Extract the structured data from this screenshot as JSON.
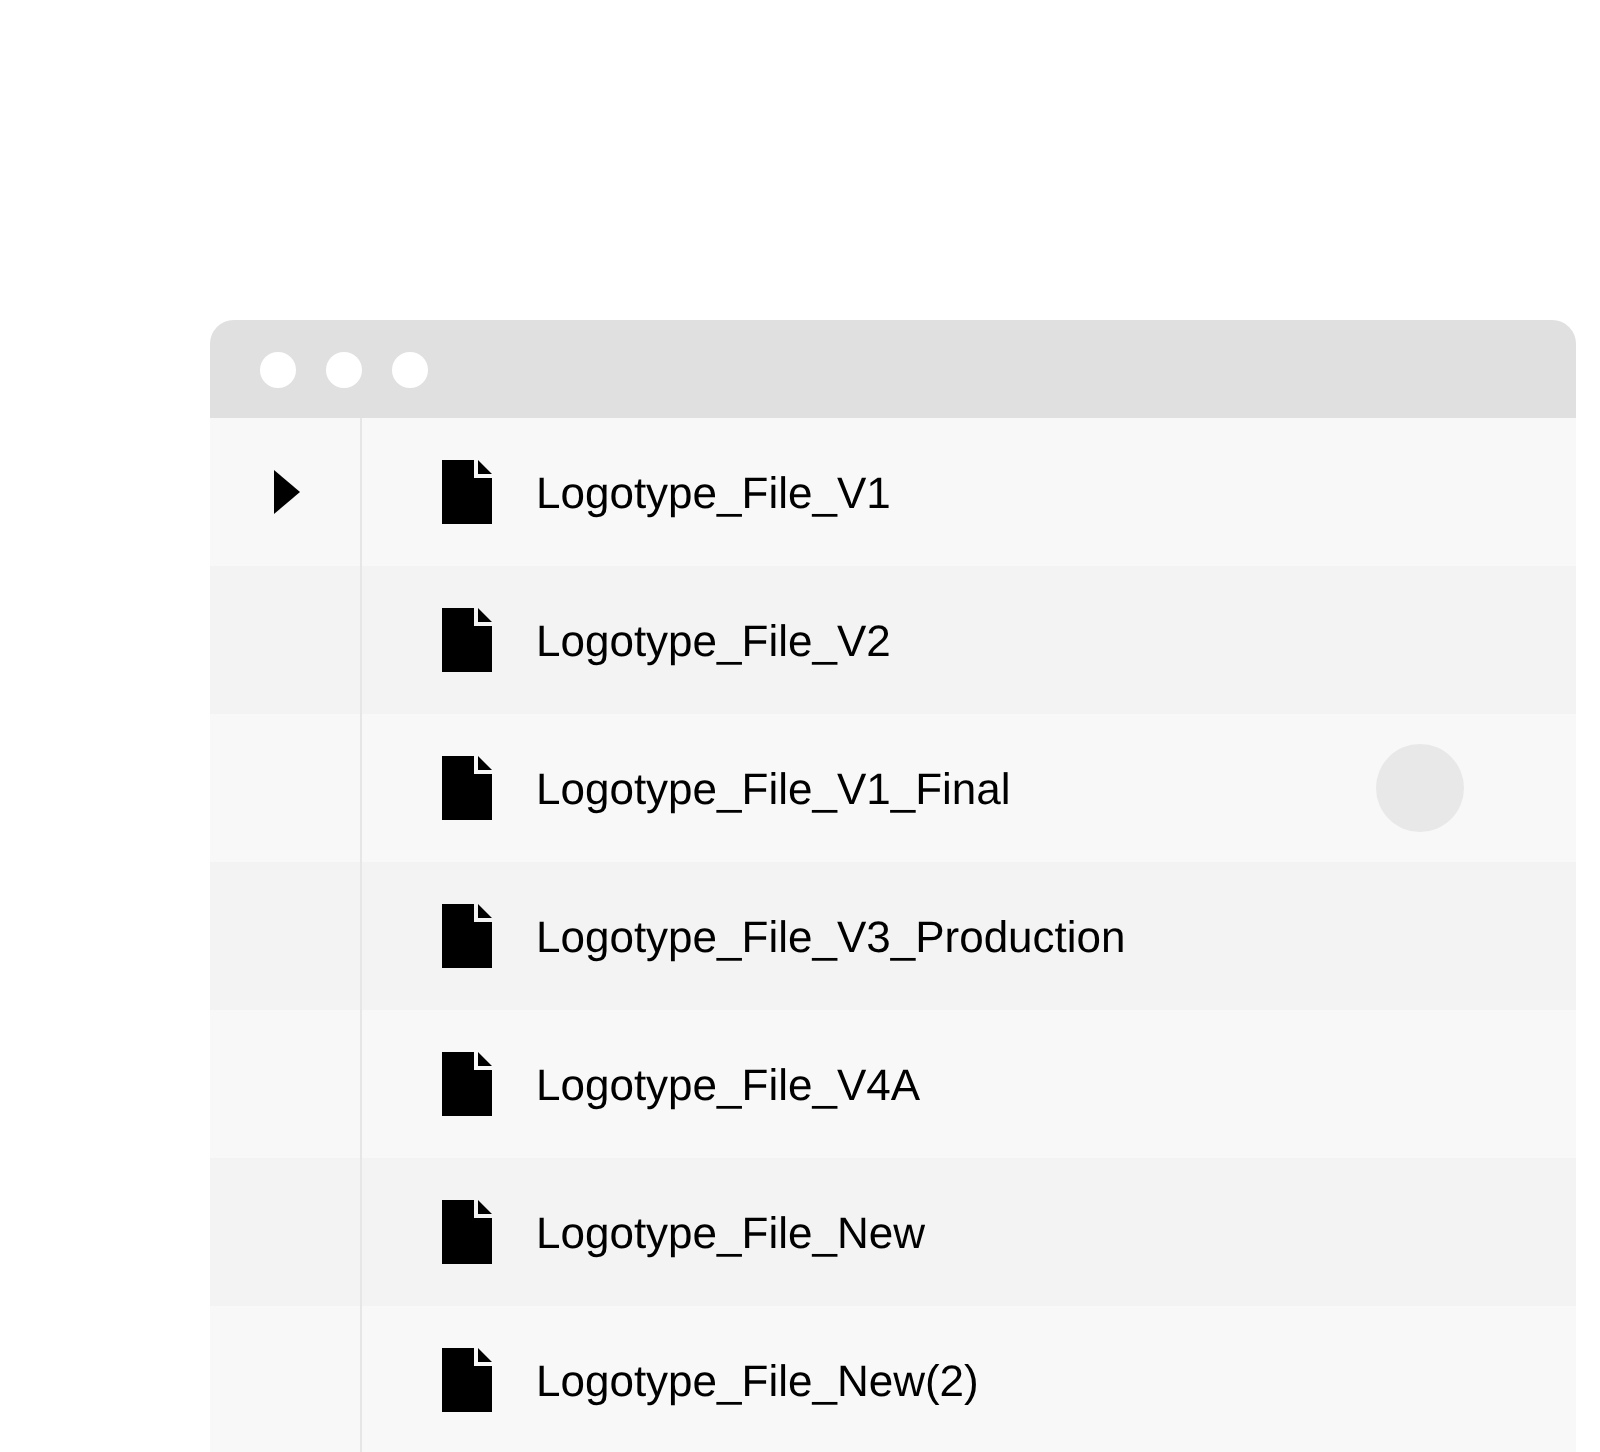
{
  "files": [
    {
      "name": "Logotype_File_V1",
      "selected": true,
      "touched": false
    },
    {
      "name": "Logotype_File_V2",
      "selected": false,
      "touched": false
    },
    {
      "name": "Logotype_File_V1_Final",
      "selected": false,
      "touched": true
    },
    {
      "name": "Logotype_File_V3_Production",
      "selected": false,
      "touched": false
    },
    {
      "name": "Logotype_File_V4A",
      "selected": false,
      "touched": false
    },
    {
      "name": "Logotype_File_New",
      "selected": false,
      "touched": false
    },
    {
      "name": "Logotype_File_New(2)",
      "selected": false,
      "touched": false
    }
  ]
}
